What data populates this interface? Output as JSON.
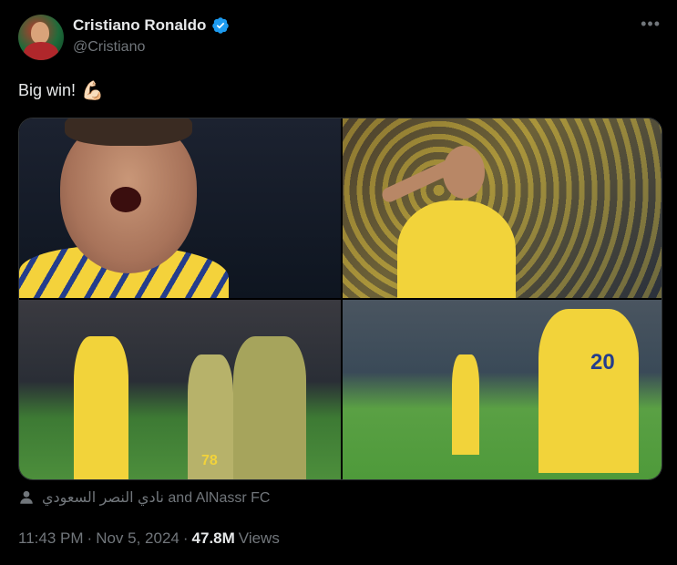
{
  "author": {
    "display_name": "Cristiano Ronaldo",
    "handle": "@Cristiano",
    "verified": true
  },
  "tweet": {
    "text": "Big win!",
    "emoji": "💪🏻"
  },
  "tags": {
    "text": "نادي النصر السعودي and AlNassr FC"
  },
  "meta": {
    "time": "11:43 PM",
    "separator1": "·",
    "date": "Nov 5, 2024",
    "separator2": "·",
    "views_count": "47.8M",
    "views_label": "Views"
  },
  "photo_text": {
    "jersey_number_1": "78",
    "jersey_number_2": "20"
  },
  "colors": {
    "background": "#000000",
    "text_primary": "#e7e9ea",
    "text_secondary": "#71767b",
    "verified_blue": "#1d9bf0"
  },
  "icons": [
    "verified-badge-icon",
    "more-icon",
    "person-tag-icon"
  ]
}
